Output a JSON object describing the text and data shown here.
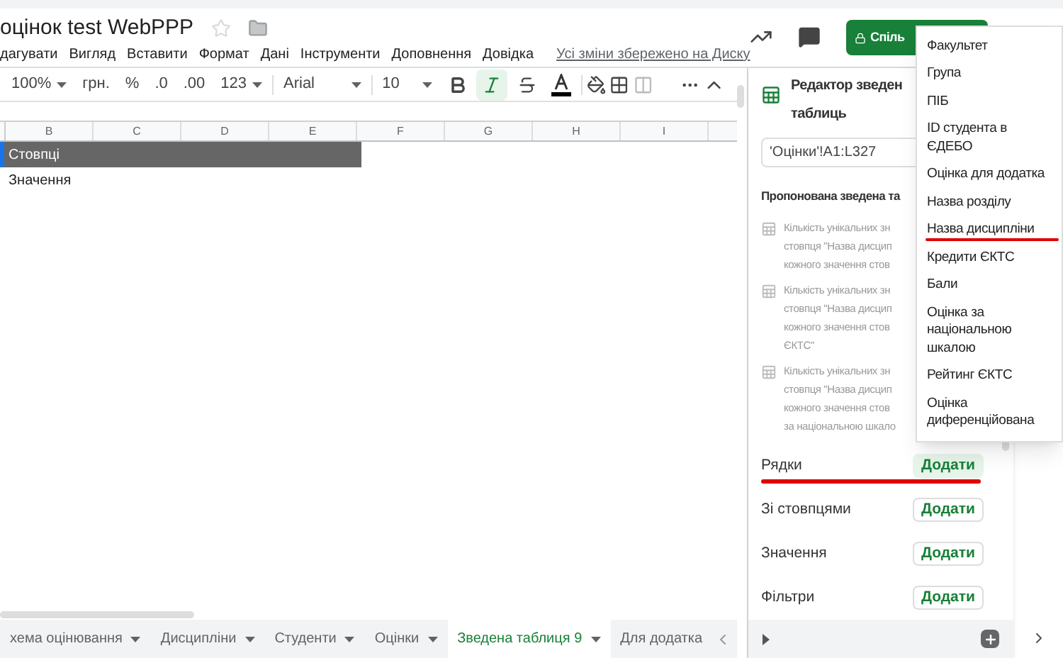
{
  "document": {
    "title": "оцінок test WebPPP",
    "starred": false
  },
  "menu_bar": {
    "items": [
      "дагувати",
      "Вигляд",
      "Вставити",
      "Формат",
      "Дані",
      "Інструменти",
      "Доповнення",
      "Довідка"
    ],
    "save_status": "Усі зміни збережено на Диску"
  },
  "share_button": {
    "label": "Спіль"
  },
  "toolbar": {
    "zoom": "100%",
    "currency": "грн.",
    "percent": "%",
    "decrease_decimals": ".0",
    "increase_decimals": ".00",
    "number_format": "123",
    "font": "Arial",
    "font_size": "10",
    "formatting": [
      {
        "kind": "bold",
        "active": false
      },
      {
        "kind": "italic",
        "active": true
      },
      {
        "kind": "strike",
        "active": false
      },
      {
        "kind": "text-color",
        "active": false
      }
    ]
  },
  "grid": {
    "columns": [
      "B",
      "C",
      "D",
      "E",
      "F",
      "G",
      "H",
      "I"
    ],
    "rows": [
      {
        "text": "Стовпці",
        "kind": "header"
      },
      {
        "text": "Значення",
        "kind": "plain"
      }
    ]
  },
  "sheet_tabs": [
    {
      "label": "хема оцінювання",
      "selected": false,
      "caret": true
    },
    {
      "label": "Дисципліни",
      "selected": false,
      "caret": true
    },
    {
      "label": "Студенти",
      "selected": false,
      "caret": true
    },
    {
      "label": "Оцінки",
      "selected": false,
      "caret": true
    },
    {
      "label": "Зведена таблиця 9",
      "selected": true,
      "caret": true
    },
    {
      "label": "Для додатка",
      "selected": false,
      "caret": false
    }
  ],
  "pivot_editor": {
    "title_lines": [
      "Редактор зведен",
      "таблиць"
    ],
    "range": "'Оцінки'!A1:L327",
    "suggested_heading": "Пропонована зведена та",
    "suggestions": [
      {
        "lines": [
          "Кількість унікальних зн",
          "стовпця \"Назва дисцип",
          "кожного значення стов"
        ]
      },
      {
        "lines": [
          "Кількість унікальних зн",
          "стовпця \"Назва дисцип",
          "кожного значення стов",
          "ЄКТС\""
        ]
      },
      {
        "lines": [
          "Кількість унікальних зн",
          "стовпця \"Назва дисцип",
          "кожного значення стов",
          "за національною шкало"
        ]
      }
    ],
    "sections": [
      {
        "label": "Рядки",
        "button": "Додати",
        "highlighted": true,
        "underlined": true
      },
      {
        "label": "Зі стовпцями",
        "button": "Додати",
        "highlighted": false,
        "underlined": false
      },
      {
        "label": "Значення",
        "button": "Додати",
        "highlighted": false,
        "underlined": false
      },
      {
        "label": "Фільтри",
        "button": "Додати",
        "highlighted": false,
        "underlined": false
      }
    ]
  },
  "field_menu": {
    "items": [
      {
        "lines": [
          "Факультет"
        ],
        "underlined": false
      },
      {
        "lines": [
          "Група"
        ],
        "underlined": false
      },
      {
        "lines": [
          "ПІБ"
        ],
        "underlined": false
      },
      {
        "lines": [
          "ID студента в",
          "ЄДЕБО"
        ],
        "underlined": false
      },
      {
        "lines": [
          "Оцінка для додатка"
        ],
        "underlined": false
      },
      {
        "lines": [
          "Назва розділу"
        ],
        "underlined": false
      },
      {
        "lines": [
          "Назва дисципліни"
        ],
        "underlined": true
      },
      {
        "lines": [
          "Кредити ЄКТС"
        ],
        "underlined": false
      },
      {
        "lines": [
          "Бали"
        ],
        "underlined": false
      },
      {
        "lines": [
          "Оцінка за",
          "національною",
          "шкалою"
        ],
        "underlined": false
      },
      {
        "lines": [
          "Рейтинг ЄКТС"
        ],
        "underlined": false
      },
      {
        "lines": [
          "Оцінка",
          "диференційована"
        ],
        "underlined": false
      }
    ]
  }
}
